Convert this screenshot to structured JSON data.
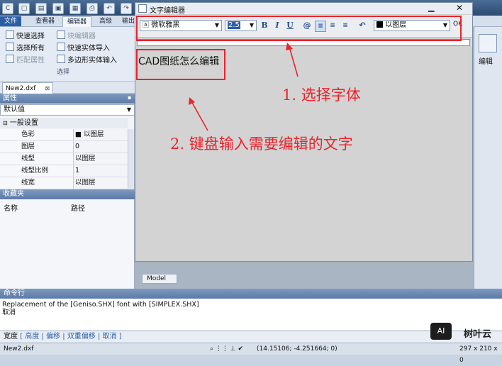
{
  "ribbon_tabs": [
    "文件",
    "查看器",
    "编辑器",
    "高级",
    "输出"
  ],
  "ribbon_items": [
    {
      "label": "快速选择",
      "dim": false
    },
    {
      "label": "选择所有",
      "dim": false
    },
    {
      "label": "匹配属性",
      "dim": true
    }
  ],
  "ribbon_items_col2": [
    {
      "label": "块编辑器",
      "dim": true
    },
    {
      "label": "快速实体导入",
      "dim": false
    },
    {
      "label": "多边形实体输入",
      "dim": false
    }
  ],
  "ribbon_group_label": "选择",
  "doc_tab": "New2.dxf",
  "properties": {
    "header": "属性",
    "selector": "默认值",
    "section": "一般设置",
    "rows": [
      {
        "key": "色彩",
        "value": "以图层"
      },
      {
        "key": "图层",
        "value": "0"
      },
      {
        "key": "线型",
        "value": "以图层"
      },
      {
        "key": "线型比例",
        "value": "1"
      },
      {
        "key": "线宽",
        "value": "以图层"
      }
    ]
  },
  "favorites": {
    "header": "收藏夹",
    "col_name": "名称",
    "col_path": "路径"
  },
  "right_panel_label": "编辑",
  "editor": {
    "title": "文字编辑器",
    "font": "微软雅黑",
    "size": "2.5",
    "bold": "B",
    "italic": "I",
    "underline": "U",
    "color": "以图层",
    "ok": "OK",
    "content": "CAD图纸怎么编辑"
  },
  "model_tab": "Model",
  "annotations": {
    "step1": "1. 选择字体",
    "step2": "2. 键盘输入需要编辑的文字"
  },
  "command": {
    "header": "命令行",
    "lines": [
      "Replacement of the [Geniso.SHX] font with [SIMPLEX.SHX]",
      "取消"
    ],
    "prompt_label": "宽度",
    "options": [
      "高度",
      "偏移",
      "双重偏移",
      "取消"
    ]
  },
  "status": {
    "file": "New2.dxf",
    "coords": "(14.15106; -4.251664; 0)",
    "paper": "297 x 210 x 0"
  },
  "watermark": "树叶云",
  "colors": {
    "accent_red": "#e8242c",
    "ribbon_blue": "#2b5ea8"
  }
}
